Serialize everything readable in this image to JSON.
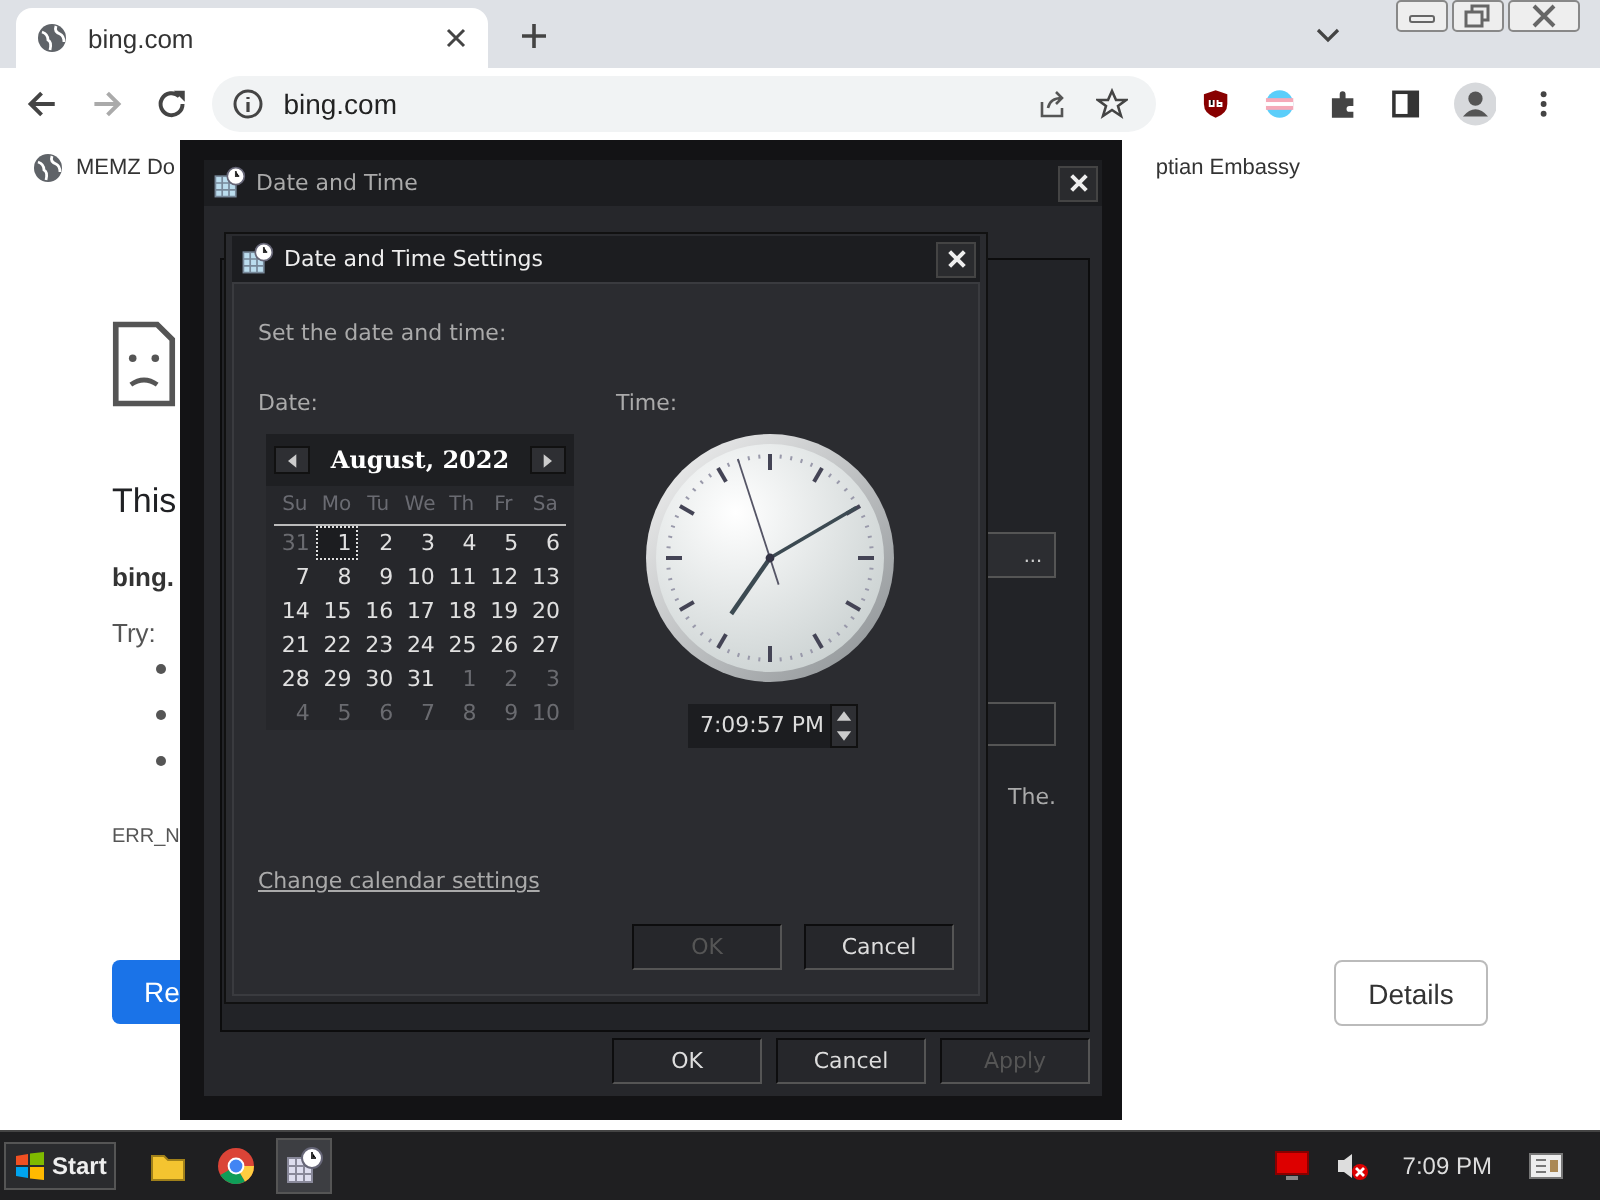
{
  "browser": {
    "tabs": [
      {
        "title": "bing.com",
        "selected": true
      }
    ],
    "address": "bing.com",
    "bookmarks": [
      {
        "label": "MEMZ Do"
      },
      {
        "label": "ptian Embassy"
      }
    ]
  },
  "page": {
    "heading": "This",
    "site": "bing.",
    "try_label": "Try:",
    "error_code": "ERR_N",
    "reload_button": "Re",
    "details_button": "Details"
  },
  "outer_dialog": {
    "title": "Date and Time",
    "side_button": "...",
    "side_text": "The.",
    "buttons": [
      {
        "label": "OK",
        "disabled": false
      },
      {
        "label": "Cancel",
        "disabled": false
      },
      {
        "label": "Apply",
        "disabled": true
      }
    ]
  },
  "settings_dialog": {
    "title": "Date and Time Settings",
    "instruction": "Set the date and time:",
    "date_label": "Date:",
    "time_label": "Time:",
    "calendar": {
      "month": "August, 2022",
      "weekdays": [
        "Su",
        "Mo",
        "Tu",
        "We",
        "Th",
        "Fr",
        "Sa"
      ],
      "weeks": [
        [
          {
            "day": "31",
            "kind": "other",
            "selected": false
          },
          {
            "day": "1",
            "kind": "current",
            "selected": true
          },
          {
            "day": "2",
            "kind": "current",
            "selected": false
          },
          {
            "day": "3",
            "kind": "current",
            "selected": false
          },
          {
            "day": "4",
            "kind": "current",
            "selected": false
          },
          {
            "day": "5",
            "kind": "current",
            "selected": false
          },
          {
            "day": "6",
            "kind": "current",
            "selected": false
          }
        ],
        [
          {
            "day": "7",
            "kind": "current",
            "selected": false
          },
          {
            "day": "8",
            "kind": "current",
            "selected": false
          },
          {
            "day": "9",
            "kind": "current",
            "selected": false
          },
          {
            "day": "10",
            "kind": "current",
            "selected": false
          },
          {
            "day": "11",
            "kind": "current",
            "selected": false
          },
          {
            "day": "12",
            "kind": "current",
            "selected": false
          },
          {
            "day": "13",
            "kind": "current",
            "selected": false
          }
        ],
        [
          {
            "day": "14",
            "kind": "current",
            "selected": false
          },
          {
            "day": "15",
            "kind": "current",
            "selected": false
          },
          {
            "day": "16",
            "kind": "current",
            "selected": false
          },
          {
            "day": "17",
            "kind": "current",
            "selected": false
          },
          {
            "day": "18",
            "kind": "current",
            "selected": false
          },
          {
            "day": "19",
            "kind": "current",
            "selected": false
          },
          {
            "day": "20",
            "kind": "current",
            "selected": false
          }
        ],
        [
          {
            "day": "21",
            "kind": "current",
            "selected": false
          },
          {
            "day": "22",
            "kind": "current",
            "selected": false
          },
          {
            "day": "23",
            "kind": "current",
            "selected": false
          },
          {
            "day": "24",
            "kind": "current",
            "selected": false
          },
          {
            "day": "25",
            "kind": "current",
            "selected": false
          },
          {
            "day": "26",
            "kind": "current",
            "selected": false
          },
          {
            "day": "27",
            "kind": "current",
            "selected": false
          }
        ],
        [
          {
            "day": "28",
            "kind": "current",
            "selected": false
          },
          {
            "day": "29",
            "kind": "current",
            "selected": false
          },
          {
            "day": "30",
            "kind": "current",
            "selected": false
          },
          {
            "day": "31",
            "kind": "current",
            "selected": false
          },
          {
            "day": "1",
            "kind": "other",
            "selected": false
          },
          {
            "day": "2",
            "kind": "other",
            "selected": false
          },
          {
            "day": "3",
            "kind": "other",
            "selected": false
          }
        ],
        [
          {
            "day": "4",
            "kind": "other",
            "selected": false
          },
          {
            "day": "5",
            "kind": "other",
            "selected": false
          },
          {
            "day": "6",
            "kind": "other",
            "selected": false
          },
          {
            "day": "7",
            "kind": "other",
            "selected": false
          },
          {
            "day": "8",
            "kind": "other",
            "selected": false
          },
          {
            "day": "9",
            "kind": "other",
            "selected": false
          },
          {
            "day": "10",
            "kind": "other",
            "selected": false
          }
        ]
      ]
    },
    "time_value": "7:09:57 PM",
    "link": "Change calendar settings",
    "buttons": [
      {
        "label": "OK",
        "disabled": true
      },
      {
        "label": "Cancel",
        "disabled": false
      }
    ]
  },
  "taskbar": {
    "start": "Start",
    "apps": [
      {
        "kind": "folder",
        "selected": false
      },
      {
        "kind": "browser",
        "selected": false
      },
      {
        "kind": "clock",
        "selected": true
      }
    ],
    "clock": "7:09 PM"
  }
}
